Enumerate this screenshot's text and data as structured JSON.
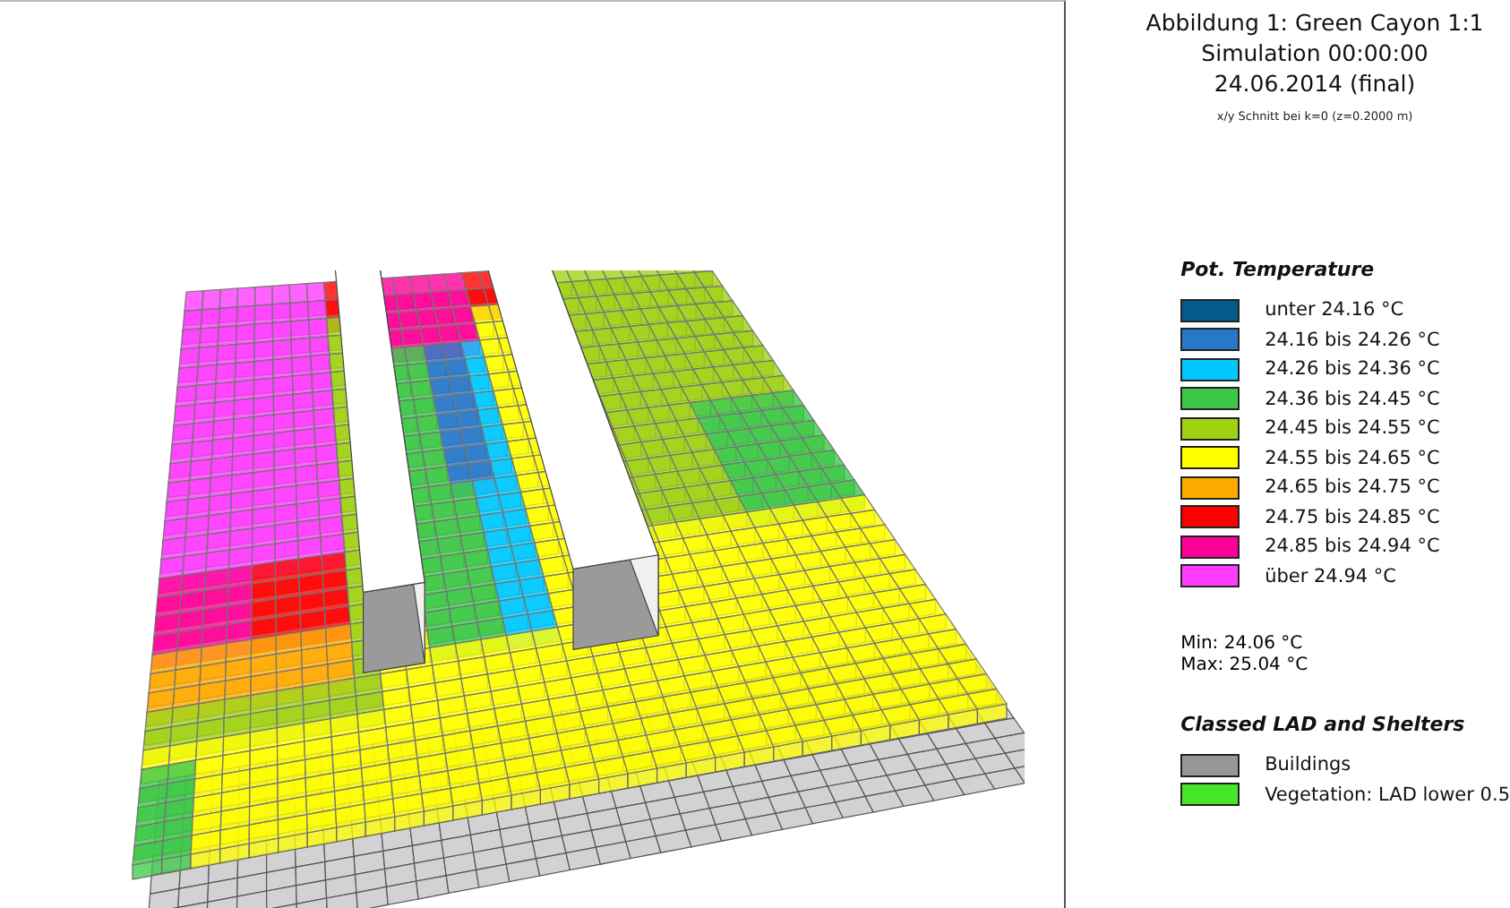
{
  "header": {
    "title": "Abbildung 1: Green Cayon 1:1",
    "simulation": "Simulation 00:00:00",
    "date": "24.06.2014 (final)",
    "section": "x/y Schnitt bei k=0 (z=0.2000 m)"
  },
  "temperature_legend": {
    "title": "Pot. Temperature",
    "items": [
      {
        "label": "unter 24.16 °C",
        "color": "#055a8c"
      },
      {
        "label": "24.16 bis 24.26 °C",
        "color": "#2878c8"
      },
      {
        "label": "24.26 bis 24.36 °C",
        "color": "#00c8ff"
      },
      {
        "label": "24.36 bis 24.45 °C",
        "color": "#3cc846"
      },
      {
        "label": "24.45 bis 24.55 °C",
        "color": "#a0d214"
      },
      {
        "label": "24.55 bis 24.65 °C",
        "color": "#ffff00"
      },
      {
        "label": "24.65 bis 24.75 °C",
        "color": "#ffaa00"
      },
      {
        "label": "24.75 bis 24.85 °C",
        "color": "#ff0000"
      },
      {
        "label": "24.85 bis 24.94 °C",
        "color": "#ff0096"
      },
      {
        "label": "über 24.94 °C",
        "color": "#ff3cff"
      }
    ]
  },
  "stats": {
    "min": "Min: 24.06 °C",
    "max": "Max: 25.04 °C"
  },
  "lad_legend": {
    "title": "Classed LAD and Shelters",
    "items": [
      {
        "label": "Buildings",
        "color": "#969696"
      },
      {
        "label": "Vegetation: LAD lower 0.5",
        "color": "#46e628"
      }
    ]
  }
}
